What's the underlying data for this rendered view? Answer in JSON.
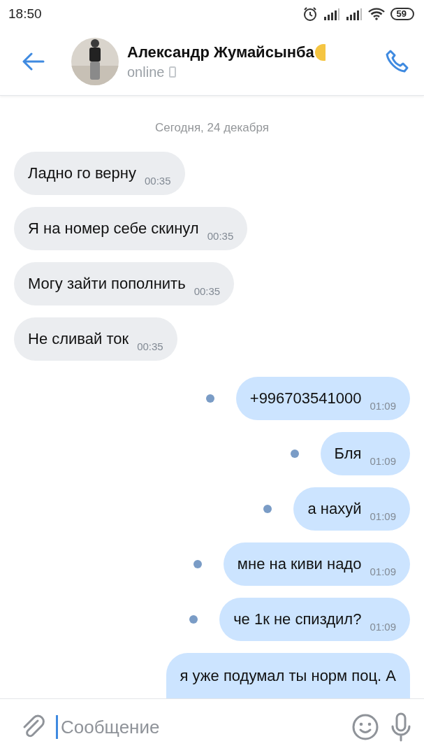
{
  "status_bar": {
    "time": "18:50",
    "battery": "59"
  },
  "header": {
    "name": "Александр Жумайсынба",
    "status": "online"
  },
  "date": "Сегодня, 24 декабря",
  "messages": [
    {
      "kind": "incoming",
      "text": "Ладно го верну",
      "time": "00:35"
    },
    {
      "kind": "incoming",
      "text": "Я на номер себе скинул",
      "time": "00:35"
    },
    {
      "kind": "incoming",
      "text": "Могу зайти пополнить",
      "time": "00:35"
    },
    {
      "kind": "incoming",
      "text": "Не сливай ток",
      "time": "00:35"
    },
    {
      "kind": "outgoing",
      "text": "+996703541000",
      "time": "01:09",
      "unread": true
    },
    {
      "kind": "outgoing",
      "text": "Бля",
      "time": "01:09",
      "unread": true
    },
    {
      "kind": "outgoing",
      "text": "а нахуй",
      "time": "01:09",
      "unread": true
    },
    {
      "kind": "outgoing",
      "text": "мне на киви надо",
      "time": "01:09",
      "unread": true
    },
    {
      "kind": "outgoing",
      "text": "че 1к не спиздил?",
      "time": "01:09",
      "unread": true
    },
    {
      "kind": "outgoing",
      "text": "я уже подумал ты норм поц. А",
      "unread": false
    }
  ],
  "composer": {
    "placeholder": "Сообщение"
  }
}
